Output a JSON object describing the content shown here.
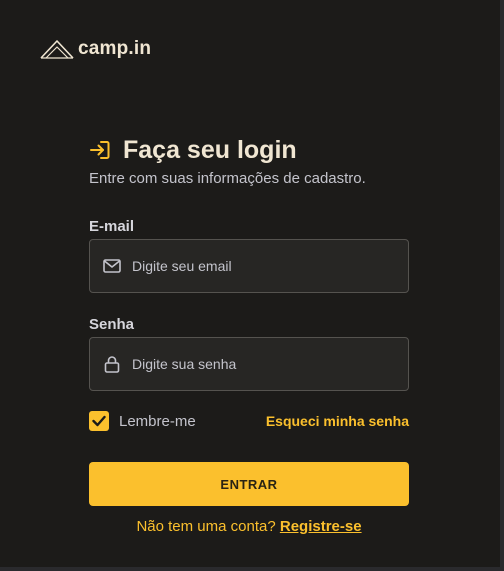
{
  "brand": {
    "name": "camp.in"
  },
  "login": {
    "title": "Faça seu login",
    "subtitle": "Entre com suas informações de cadastro.",
    "email": {
      "label": "E-mail",
      "value": "",
      "placeholder": "Digite seu email"
    },
    "password": {
      "label": "Senha",
      "value": "",
      "placeholder": "Digite sua senha"
    },
    "remember": {
      "label": "Lembre-me",
      "checked": true
    },
    "forgot_label": "Esqueci minha senha",
    "submit_label": "ENTRAR",
    "signup_prompt": "Não tem uma conta?",
    "signup_link": "Registre-se"
  },
  "colors": {
    "accent": "#fbc02d",
    "background": "#1c1b19",
    "title": "#f0e6d2",
    "input_background": "#272624"
  },
  "icons": {
    "logo": "tent-icon",
    "title": "sign-in-icon",
    "email": "mail-icon",
    "password": "lock-icon",
    "checkbox": "check-icon"
  }
}
